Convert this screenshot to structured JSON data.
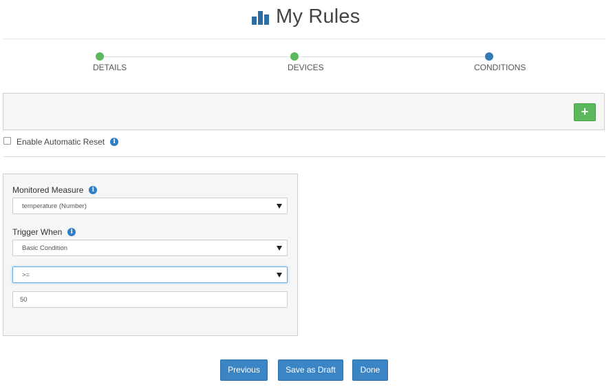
{
  "header": {
    "title": "My Rules",
    "icon": "bar-chart-icon"
  },
  "steps": [
    {
      "label": "DETAILS",
      "status": "complete",
      "color": "#5cb85c"
    },
    {
      "label": "DEVICES",
      "status": "complete",
      "color": "#5cb85c"
    },
    {
      "label": "CONDITIONS",
      "status": "current",
      "color": "#337ab7"
    }
  ],
  "conditions_bar": {
    "add_label": "+",
    "add_icon": "plus-icon"
  },
  "reset": {
    "label": "Enable Automatic Reset",
    "checked": false,
    "info_glyph": "i"
  },
  "panel": {
    "monitored_measure": {
      "label": "Monitored Measure",
      "value": "temperature (Number)"
    },
    "trigger_when": {
      "label": "Trigger When",
      "value": "Basic Condition"
    },
    "operator": {
      "value": ">="
    },
    "threshold": {
      "value": "50"
    },
    "info_glyph": "i"
  },
  "buttons": {
    "previous": "Previous",
    "save_draft": "Save as Draft",
    "done": "Done"
  },
  "colors": {
    "primary": "#3c85c5",
    "success": "#5cb85c",
    "info": "#2f7ec6"
  }
}
